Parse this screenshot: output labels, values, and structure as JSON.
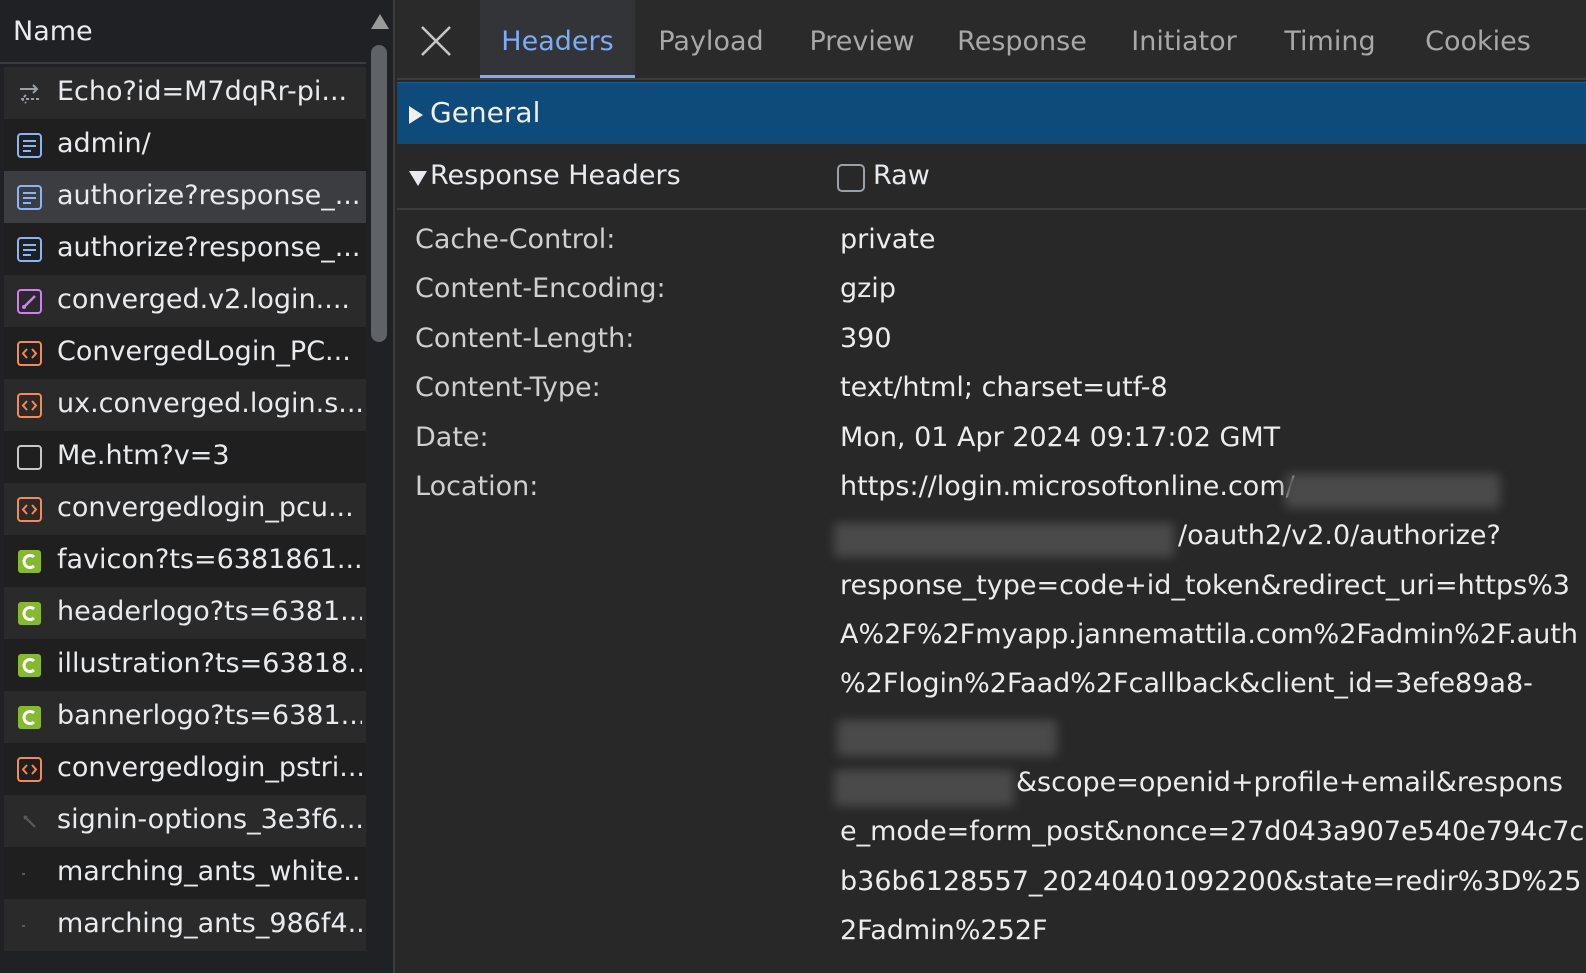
{
  "list": {
    "header": "Name",
    "items": [
      {
        "label": "Echo?id=M7dqRr-pi...",
        "icon": "fetch-xhr-icon"
      },
      {
        "label": "admin/",
        "icon": "document-icon"
      },
      {
        "label": "authorize?response_...",
        "icon": "document-icon"
      },
      {
        "label": "authorize?response_...",
        "icon": "document-icon"
      },
      {
        "label": "converged.v2.login....",
        "icon": "stylesheet-icon"
      },
      {
        "label": "ConvergedLogin_PC...",
        "icon": "script-icon"
      },
      {
        "label": "ux.converged.login.s...",
        "icon": "script-icon"
      },
      {
        "label": "Me.htm?v=3",
        "icon": "other-icon"
      },
      {
        "label": "convergedlogin_pcu...",
        "icon": "script-icon"
      },
      {
        "label": "favicon?ts=6381861...",
        "icon": "image-icon"
      },
      {
        "label": "headerlogo?ts=6381...",
        "icon": "image-icon"
      },
      {
        "label": "illustration?ts=63818...",
        "icon": "image-icon"
      },
      {
        "label": "bannerlogo?ts=6381...",
        "icon": "image-icon"
      },
      {
        "label": "convergedlogin_pstri...",
        "icon": "script-icon"
      },
      {
        "label": "signin-options_3e3f6...",
        "icon": "svg-image-icon"
      },
      {
        "label": "marching_ants_white...",
        "icon": "gif-image-icon"
      },
      {
        "label": "marching_ants_986f4...",
        "icon": "gif-image-icon"
      }
    ],
    "selected_index": 2
  },
  "tabs": [
    "Headers",
    "Payload",
    "Preview",
    "Response",
    "Initiator",
    "Timing",
    "Cookies"
  ],
  "active_tab": "Headers",
  "general": {
    "label": "General"
  },
  "response_headers": {
    "label": "Response Headers",
    "raw_label": "Raw",
    "raw_checked": false,
    "rows": [
      {
        "name": "Cache-Control:",
        "value": "private"
      },
      {
        "name": "Content-Encoding:",
        "value": "gzip"
      },
      {
        "name": "Content-Length:",
        "value": "390"
      },
      {
        "name": "Content-Type:",
        "value": "text/html; charset=utf-8"
      },
      {
        "name": "Date:",
        "value": "Mon, 01 Apr 2024 09:17:02 GMT"
      },
      {
        "name": "Location:",
        "value": ""
      }
    ],
    "location_lines": [
      "https://login.microsoftonline.com/",
      "/oauth2/v2.0/authorize?",
      "response_type=code+id_token&redirect_uri=https%3",
      "A%2F%2Fmyapp.jannemattila.com%2Fadmin%2F.auth",
      "%2Flogin%2Faad%2Fcallback&client_id=3efe89a8-",
      "",
      "&scope=openid+profile+email&respons",
      "e_mode=form_post&nonce=27d043a907e540e794c7c",
      "b36b6128557_20240401092200&state=redir%3D%25",
      "2Fadmin%252F"
    ]
  },
  "colors": {
    "accent": "#7cacf8",
    "general_bg": "#0e4a7a",
    "doc_icon": "#8ab4f8",
    "css_icon": "#d17ef0",
    "script_icon": "#f28b54",
    "image_icon": "#86b832"
  }
}
